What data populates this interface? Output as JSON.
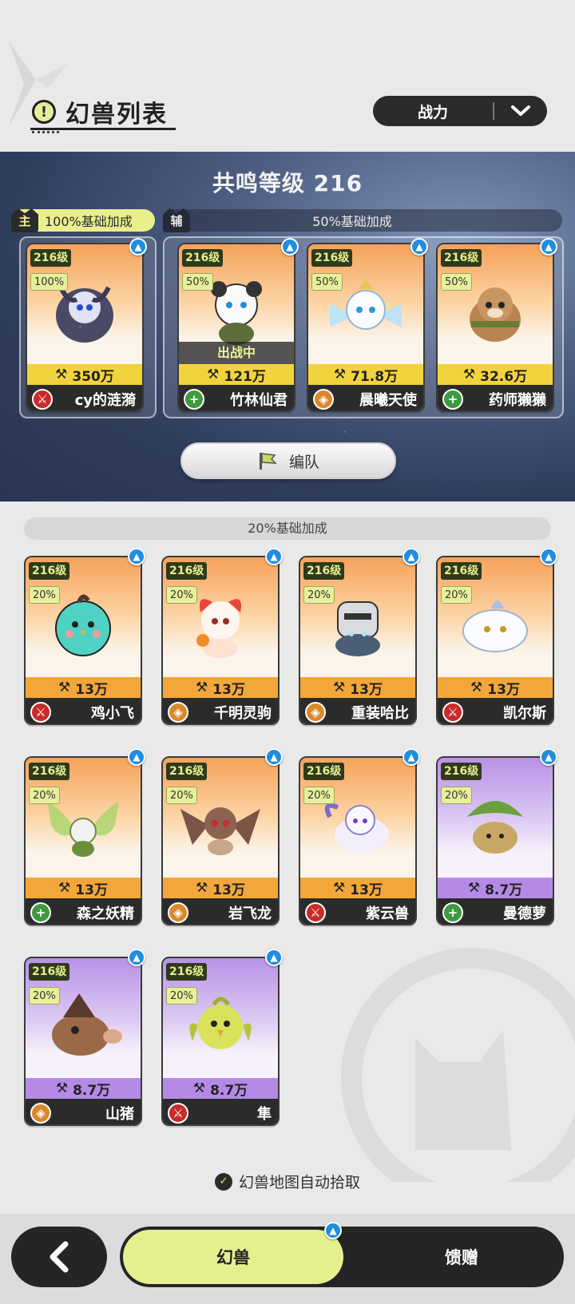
{
  "header": {
    "title": "幻兽列表",
    "sort_label": "战力"
  },
  "resonance": {
    "level_text": "共鸣等级 216",
    "main_tag": "主",
    "main_bonus": "100%基础加成",
    "aux_tag": "辅",
    "aux_bonus": "50%基础加成",
    "formation_label": "编队"
  },
  "team": [
    {
      "level": "216级",
      "pct": "100%",
      "power": "350万",
      "name": "cy的涟漪",
      "role": "attack",
      "deployed": false
    },
    {
      "level": "216级",
      "pct": "50%",
      "power": "121万",
      "name": "竹林仙君",
      "role": "heal",
      "deployed": true,
      "deployed_label": "出战中"
    },
    {
      "level": "216级",
      "pct": "50%",
      "power": "71.8万",
      "name": "晨曦天使",
      "role": "defense",
      "deployed": false
    },
    {
      "level": "216级",
      "pct": "50%",
      "power": "32.6万",
      "name": "药师獭獭",
      "role": "heal",
      "deployed": false
    }
  ],
  "others_section_label": "20%基础加成",
  "others": [
    {
      "level": "216级",
      "pct": "20%",
      "power": "13万",
      "name": "鸡小飞",
      "role": "attack",
      "tier": "orange"
    },
    {
      "level": "216级",
      "pct": "20%",
      "power": "13万",
      "name": "千明灵驹",
      "role": "defense",
      "tier": "orange"
    },
    {
      "level": "216级",
      "pct": "20%",
      "power": "13万",
      "name": "重装哈比",
      "role": "defense",
      "tier": "orange"
    },
    {
      "level": "216级",
      "pct": "20%",
      "power": "13万",
      "name": "凯尔斯",
      "role": "attack",
      "tier": "orange"
    },
    {
      "level": "216级",
      "pct": "20%",
      "power": "13万",
      "name": "森之妖精",
      "role": "heal",
      "tier": "orange"
    },
    {
      "level": "216级",
      "pct": "20%",
      "power": "13万",
      "name": "岩飞龙",
      "role": "defense",
      "tier": "orange"
    },
    {
      "level": "216级",
      "pct": "20%",
      "power": "13万",
      "name": "紫云兽",
      "role": "attack",
      "tier": "orange"
    },
    {
      "level": "216级",
      "pct": "20%",
      "power": "8.7万",
      "name": "曼德萝",
      "role": "heal",
      "tier": "purple"
    },
    {
      "level": "216级",
      "pct": "20%",
      "power": "8.7万",
      "name": "山猪",
      "role": "defense",
      "tier": "purple"
    },
    {
      "level": "216级",
      "pct": "20%",
      "power": "8.7万",
      "name": "隼",
      "role": "attack",
      "tier": "purple"
    }
  ],
  "auto_pick_label": "幻兽地图自动拾取",
  "nav": {
    "tab_beasts": "幻兽",
    "tab_gift": "馈赠"
  },
  "colors": {
    "accent": "#e6ef8e",
    "dark": "#252525",
    "upgrade_blue": "#1f8de0",
    "orange_card": "#f3a63a",
    "purple_card": "#b58ae6"
  }
}
